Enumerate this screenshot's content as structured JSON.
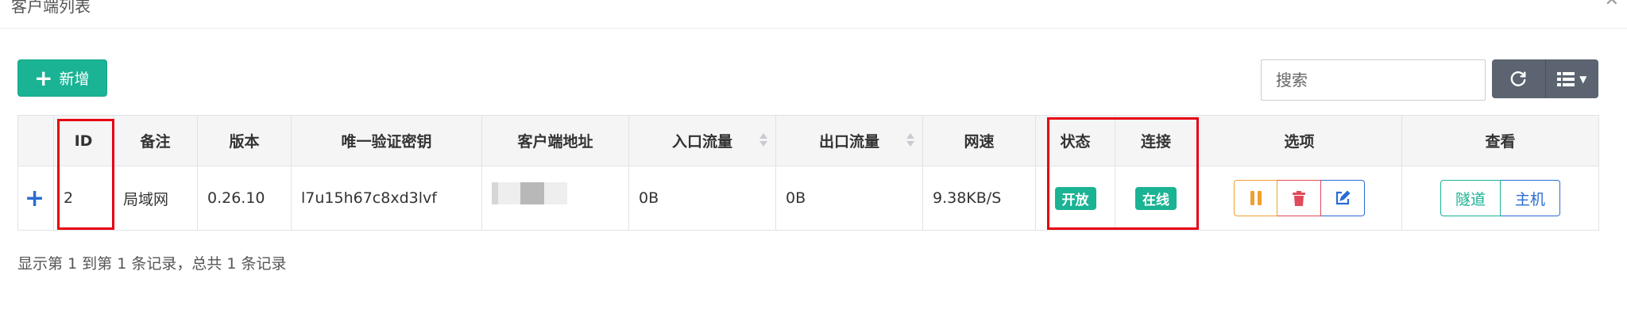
{
  "panel": {
    "title": "客户端列表",
    "icons": [
      "chevron-up-icon",
      "close-icon"
    ]
  },
  "toolbar": {
    "add_label": "新增",
    "search_placeholder": "搜索",
    "refresh_icon": "refresh-icon",
    "columns_icon": "list-columns-icon"
  },
  "table": {
    "headers": [
      "",
      "ID",
      "备注",
      "版本",
      "唯一验证密钥",
      "客户端地址",
      "入口流量",
      "出口流量",
      "网速",
      "状态",
      "连接",
      "选项",
      "查看"
    ],
    "rows": [
      {
        "expand": "+",
        "id": "2",
        "remark": "局域网",
        "version": "0.26.10",
        "key": "l7u15h67c8xd3lvf",
        "address": "",
        "in_flow": "0B",
        "out_flow": "0B",
        "speed": "9.38KB/S",
        "status": "开放",
        "connection": "在线",
        "option_icons": [
          "pause-icon",
          "trash-icon",
          "edit-icon"
        ],
        "view_buttons": [
          "隧道",
          "主机"
        ]
      }
    ]
  },
  "footer": {
    "summary": "显示第 1 到第 1 条记录，总共 1 条记录"
  },
  "colors": {
    "accent": "#1ab394",
    "primary": "#2b6cd4",
    "danger": "#e04a5a",
    "warning": "#f0a030",
    "highlight": "#e60012"
  }
}
